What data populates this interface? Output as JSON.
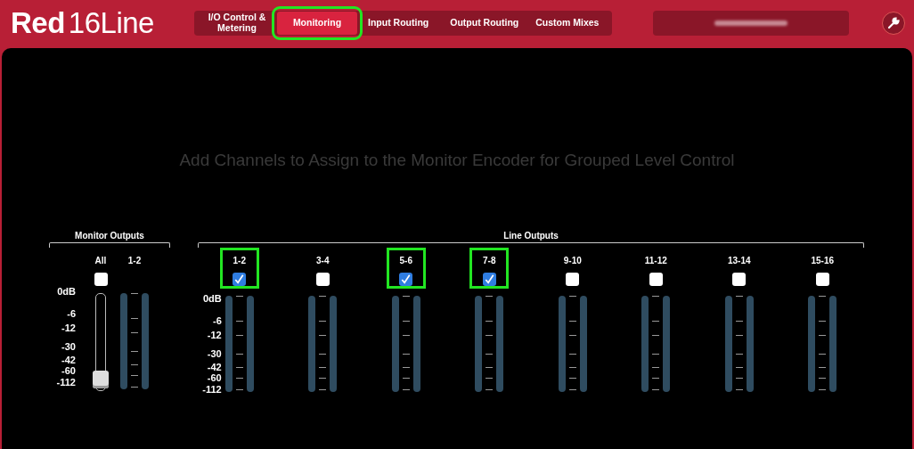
{
  "app": {
    "logo_bold": "Red",
    "logo_light": "16Line"
  },
  "tabs": [
    {
      "label": "I/O Control & Metering",
      "selected": false,
      "highlighted": false
    },
    {
      "label": "Monitoring",
      "selected": true,
      "highlighted": true
    },
    {
      "label": "Input Routing",
      "selected": false,
      "highlighted": false
    },
    {
      "label": "Output Routing",
      "selected": false,
      "highlighted": false
    },
    {
      "label": "Custom Mixes",
      "selected": false,
      "highlighted": false
    }
  ],
  "heading": "Add Channels to Assign to the Monitor Encoder for Grouped Level Control",
  "monitor_outputs": {
    "title": "Monitor Outputs",
    "scale": [
      "0dB",
      "-6",
      "-12",
      "-30",
      "-42",
      "-60",
      "-112"
    ],
    "all_label": "All",
    "all_checked": false,
    "fader": {
      "level": 0.02
    },
    "channel_label": "1-2"
  },
  "line_outputs": {
    "title": "Line Outputs",
    "scale": [
      "0dB",
      "-6",
      "-12",
      "-30",
      "-42",
      "-60",
      "-112"
    ],
    "channels": [
      {
        "label": "1-2",
        "checked": true,
        "highlighted": true
      },
      {
        "label": "3-4",
        "checked": false,
        "highlighted": false
      },
      {
        "label": "5-6",
        "checked": true,
        "highlighted": true
      },
      {
        "label": "7-8",
        "checked": true,
        "highlighted": true
      },
      {
        "label": "9-10",
        "checked": false,
        "highlighted": false
      },
      {
        "label": "11-12",
        "checked": false,
        "highlighted": false
      },
      {
        "label": "13-14",
        "checked": false,
        "highlighted": false
      },
      {
        "label": "15-16",
        "checked": false,
        "highlighted": false
      }
    ]
  }
}
